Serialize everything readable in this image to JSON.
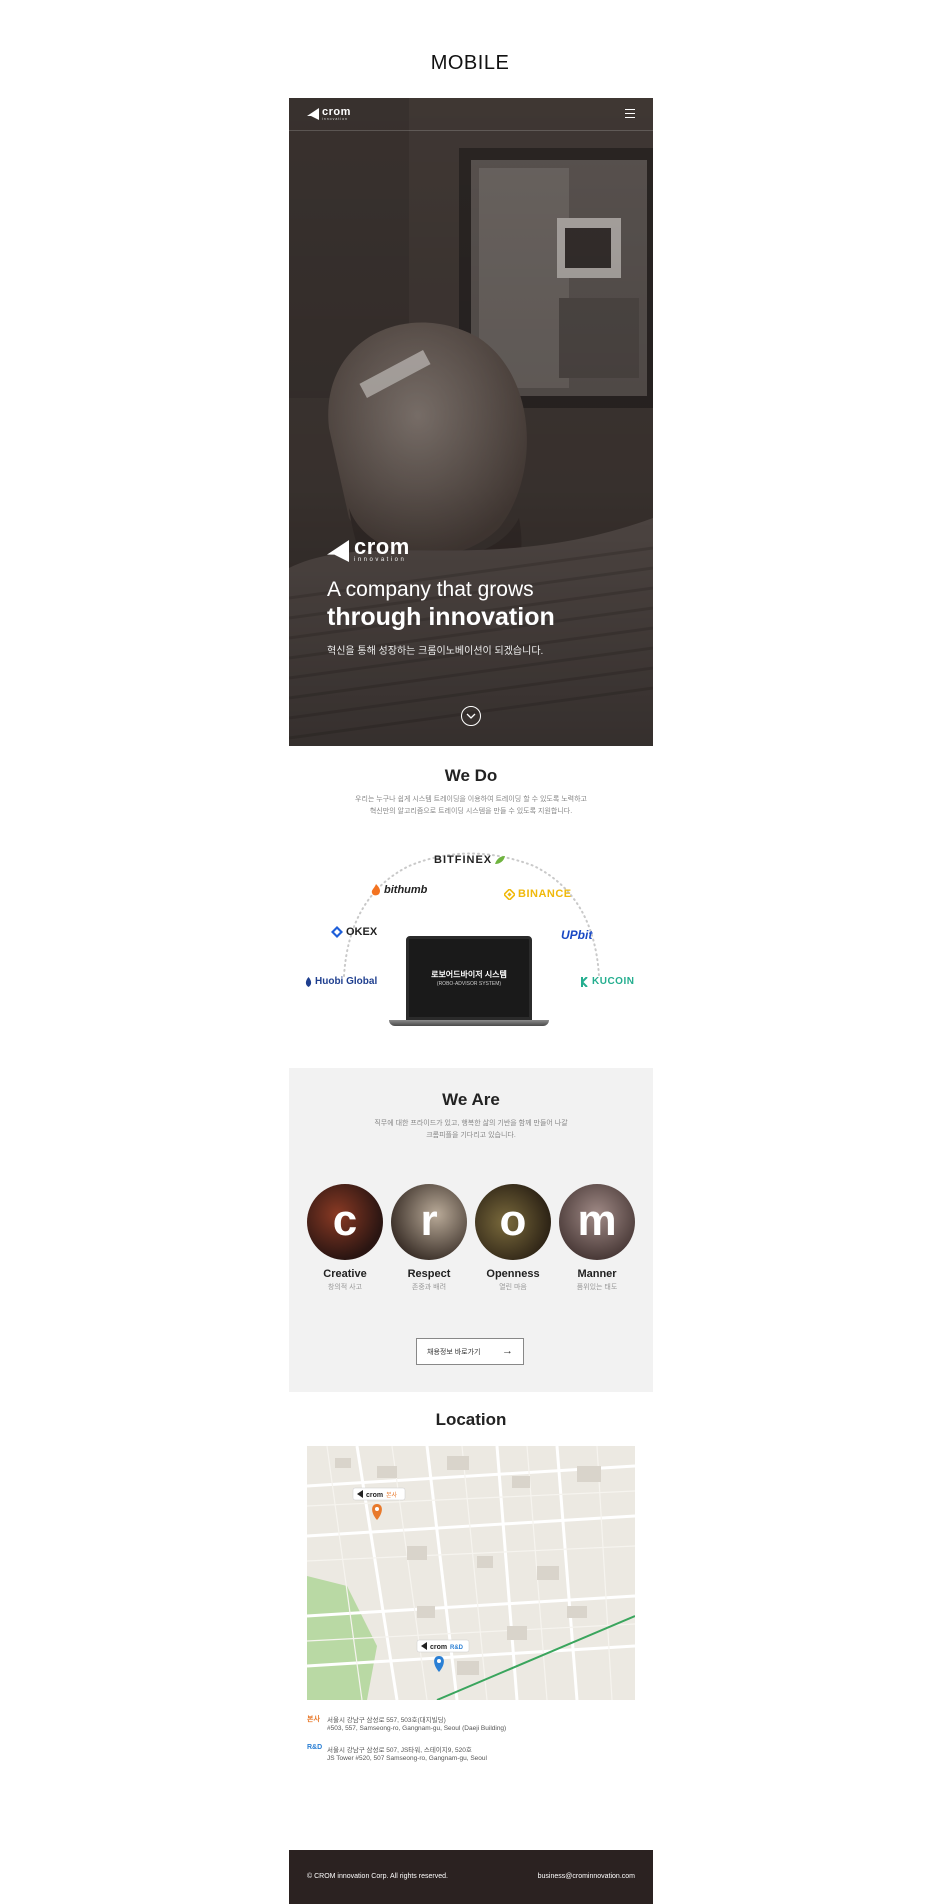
{
  "page": {
    "title": "MOBILE"
  },
  "hero": {
    "logo_word": "crom",
    "logo_sub": "innovation",
    "headline_line1": "A company that grows",
    "headline_line2": "through innovation",
    "subtitle": "혁신을 통해 성장하는 크롬이노베이션이 되겠습니다."
  },
  "wedo": {
    "title": "We Do",
    "desc_line1": "우리는 누구나 쉽게 시스템 트레이딩을 이용하여 트레이딩 할 수 있도록 노력하고",
    "desc_line2": "혁신만의 알고리즘으로 트레이딩 시스템을 만들 수 있도록 지원합니다.",
    "exchanges": {
      "bitfinex": "BITFINEX",
      "bithumb": "bithumb",
      "binance": "BINANCE",
      "okex": "OKEX",
      "upbit": "UPbit",
      "huobi": "Huobi Global",
      "kucoin": "KUCOIN"
    },
    "laptop_title": "로보어드바이저 시스템",
    "laptop_sub": "(ROBO-ADVISOR SYSTEM)"
  },
  "weare": {
    "title": "We Are",
    "desc_line1": "직무에 대한 프라이드가 있고, 행복한 삶의 기반을 함께 만들어 나갈",
    "desc_line2": "크롬피플을 기다리고 있습니다.",
    "values": [
      {
        "letter": "c",
        "name": "Creative",
        "ko": "창의적 사고"
      },
      {
        "letter": "r",
        "name": "Respect",
        "ko": "존중과 배려"
      },
      {
        "letter": "o",
        "name": "Openness",
        "ko": "열린 마음"
      },
      {
        "letter": "m",
        "name": "Manner",
        "ko": "품위있는 태도"
      }
    ],
    "career_button": "채용정보 바로가기",
    "career_arrow": "→"
  },
  "location": {
    "title": "Location",
    "map_label_hq": "본사",
    "map_label_rd": "R&D",
    "hq_tag": "본사",
    "hq_line1": "서울시 강남구 삼성로 557, 503호(대지빌딩)",
    "hq_line2": "#503, 557, Samseong-ro, Gangnam-gu, Seoul (Daeji Building)",
    "rd_tag": "R&D",
    "rd_line1": "서울시 강남구 삼성로 507, JS타워, 스테이지9, 520호",
    "rd_line2": "JS Tower #520, 507 Samseong-ro, Gangnam-gu, Seoul"
  },
  "footer": {
    "copyright": "© CROM innovation Corp. All rights reserved.",
    "email": "business@crominnovation.com"
  },
  "colors": {
    "hq_accent": "#e8792b",
    "rd_accent": "#2a7fd4",
    "footer_bg": "#2b2221",
    "binance": "#f0b90b",
    "upbit": "#1a49c4",
    "kucoin": "#24ae8f",
    "bithumb": "#f37321"
  }
}
